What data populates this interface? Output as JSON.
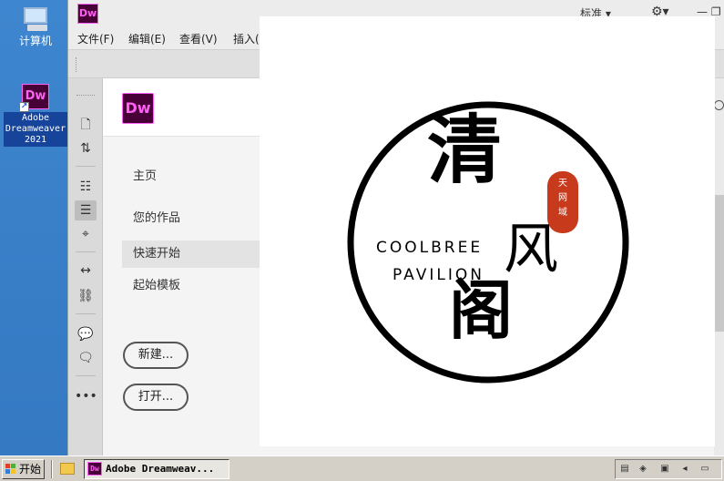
{
  "desktop": {
    "icons": [
      {
        "label": "计算机"
      },
      {
        "label_lines": [
          "Adobe",
          "Dreamweaver",
          "2021"
        ]
      }
    ]
  },
  "app": {
    "logo": "Dw",
    "workspace_label": "标准 ▾",
    "gear": "⚙▾",
    "window_controls": "— ❐"
  },
  "menu": [
    "文件(F)",
    "编辑(E)",
    "查看(V)",
    "插入("
  ],
  "tools": {
    "more": "•••"
  },
  "start": {
    "logo": "Dw",
    "nav": [
      "主页",
      "您的作品",
      "快速开始",
      "起始模板"
    ],
    "buttons": {
      "new": "新建...",
      "open": "打开..."
    }
  },
  "overlay": {
    "main_char": "清",
    "char_feng": "风",
    "char_ge": "阁",
    "seal_chars": [
      "天",
      "网",
      "域"
    ],
    "english_line1": "COOLBREE",
    "english_line2": "PAVILION"
  },
  "taskbar": {
    "start_label": "开始",
    "task_label": "Adobe Dreamweav...",
    "task_icon": "Dw"
  },
  "colors": {
    "dw_bg": "#470137",
    "dw_accent": "#ff61f6",
    "seal_red": "#c73a1c",
    "desktop_blue": "#3e86cf"
  }
}
